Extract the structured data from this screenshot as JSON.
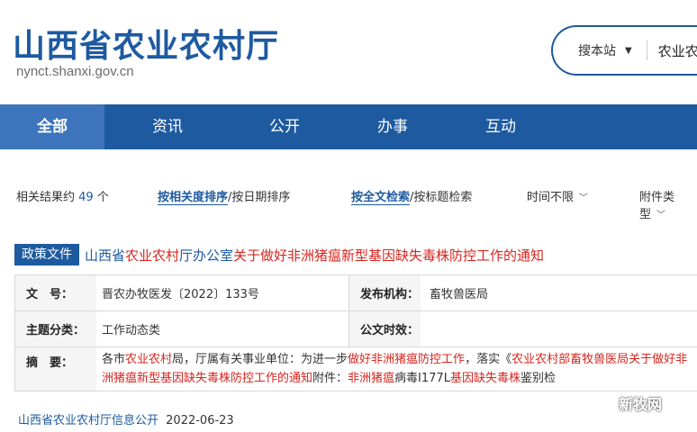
{
  "site": {
    "title": "山西省农业农村厅",
    "url": "nynct.shanxi.gov.cn"
  },
  "search": {
    "scope_label": "搜本站",
    "query": "农业农"
  },
  "nav": [
    {
      "label": "全部",
      "active": true
    },
    {
      "label": "资讯",
      "active": false
    },
    {
      "label": "公开",
      "active": false
    },
    {
      "label": "办事",
      "active": false
    },
    {
      "label": "互动",
      "active": false
    }
  ],
  "filter": {
    "count_prefix": "相关结果约",
    "count": "49",
    "count_suffix": "个",
    "sort_relevance": "按相关度排序",
    "sort_sep1": "/",
    "sort_date": "按日期排序",
    "search_full": "按全文检索",
    "search_sep": "/",
    "search_title": "按标题检索",
    "time_label": "时间不限",
    "attach_label": "附件类型"
  },
  "result": {
    "tag": "政策文件",
    "title_parts": [
      {
        "text": "山西省",
        "hl": false
      },
      {
        "text": "农业农村",
        "hl": true
      },
      {
        "text": "厅办公室",
        "hl": false
      },
      {
        "text": "关于做好非洲猪瘟新型基因缺失毒株防控工作的通知",
        "hl": true
      }
    ],
    "doc_no_label": "文　号：",
    "doc_no": "晋农办牧医发〔2022〕133号",
    "issuer_label": "发布机构：",
    "issuer": "畜牧兽医局",
    "category_label": "主题分类：",
    "category": "工作动态类",
    "validity_label": "公文时效：",
    "validity": "",
    "abstract_label": "摘　要：",
    "abstract_parts": [
      {
        "text": "各市",
        "hl": false
      },
      {
        "text": "农业农村",
        "hl": true
      },
      {
        "text": "局，厅属有关事业单位：为进一步",
        "hl": false
      },
      {
        "text": "做好非洲猪瘟防控工作",
        "hl": true
      },
      {
        "text": "，落实《",
        "hl": false
      },
      {
        "text": "农业农村部畜牧兽医局关于做好非洲猪瘟新型基因缺失毒株防控工作的通知",
        "hl": true
      },
      {
        "text": "附件：",
        "hl": false
      },
      {
        "text": "非洲猪瘟",
        "hl": true
      },
      {
        "text": "病毒I177L",
        "hl": false
      },
      {
        "text": "基因缺失毒株",
        "hl": true
      },
      {
        "text": "鉴别检",
        "hl": false
      }
    ],
    "source": "山西省农业农村厅信息公开",
    "date": "2022-06-23"
  },
  "watermark": "新牧网"
}
